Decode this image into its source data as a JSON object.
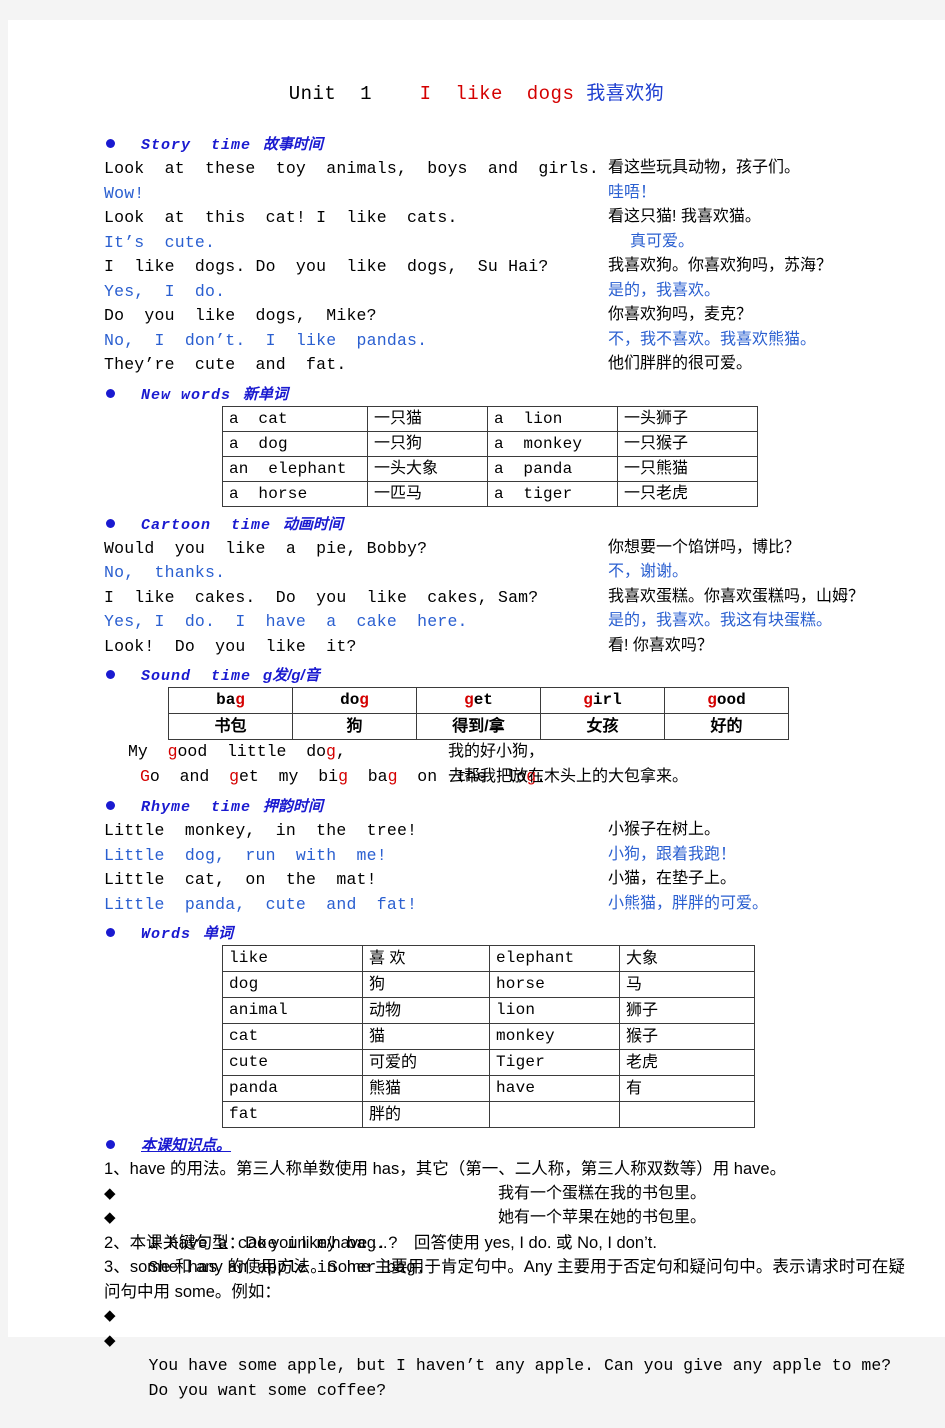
{
  "title": {
    "unit": "Unit  1",
    "en": "I  like  dogs",
    "cn": "我喜欢狗"
  },
  "sections": {
    "story": {
      "en": "Story  time",
      "cn": "故事时间",
      "lines": [
        {
          "en": "Look  at  these  toy  animals,  boys  and  girls.",
          "cn": "看这些玩具动物，孩子们。",
          "color": "black"
        },
        {
          "en": "Wow!",
          "cn": "哇唔！",
          "color": "blue"
        },
        {
          "en": "Look  at  this  cat! I  like  cats.",
          "cn": "看这只猫! 我喜欢猫。",
          "color": "black"
        },
        {
          "en": "It’s  cute.",
          "cn": "真可爱。",
          "color": "blue",
          "indent_cn": true
        },
        {
          "en": "I  like  dogs. Do  you  like  dogs,  Su Hai?",
          "cn": "我喜欢狗。你喜欢狗吗，苏海？",
          "color": "black"
        },
        {
          "en": "Yes,  I  do.",
          "cn": "是的，我喜欢。",
          "color": "blue"
        },
        {
          "en": "Do  you  like  dogs,  Mike?",
          "cn": "你喜欢狗吗，麦克？",
          "color": "black"
        },
        {
          "en": "No,  I  don’t.  I  like  pandas.",
          "cn": "不，我不喜欢。我喜欢熊猫。",
          "color": "blue"
        },
        {
          "en": "They’re  cute  and  fat.",
          "cn": "他们胖胖的很可爱。",
          "color": "black"
        }
      ]
    },
    "new_words": {
      "en": "New words",
      "cn": "新单词",
      "rows": [
        [
          "a  cat",
          "一只猫",
          "a  lion",
          "一头狮子"
        ],
        [
          "a  dog",
          "一只狗",
          "a  monkey",
          "一只猴子"
        ],
        [
          "an  elephant",
          "一头大象",
          "a  panda",
          "一只熊猫"
        ],
        [
          "a  horse",
          "一匹马",
          "a  tiger",
          "一只老虎"
        ]
      ]
    },
    "cartoon": {
      "en": "Cartoon  time",
      "cn": "动画时间",
      "lines": [
        {
          "en": "Would  you  like  a  pie, Bobby?",
          "cn": "你想要一个馅饼吗，博比？",
          "color": "black"
        },
        {
          "en": "No,  thanks.",
          "cn": "不，谢谢。",
          "color": "blue"
        },
        {
          "en": "I  like  cakes.  Do  you  like  cakes, Sam?",
          "cn": "我喜欢蛋糕。你喜欢蛋糕吗，山姆？",
          "color": "black"
        },
        {
          "en": "Yes, I  do.  I  have  a  cake  here.",
          "cn": "是的，我喜欢。我这有块蛋糕。",
          "color": "blue"
        },
        {
          "en": "Look!  Do  you  like  it?",
          "cn": "看! 你喜欢吗？",
          "color": "black"
        }
      ]
    },
    "sound": {
      "en": "Sound  time",
      "cn": "g发/g/音",
      "words": [
        {
          "pre": "ba",
          "hl": "g",
          "post": ""
        },
        {
          "pre": "do",
          "hl": "g",
          "post": ""
        },
        {
          "pre": "",
          "hl": "g",
          "post": "et"
        },
        {
          "pre": "",
          "hl": "g",
          "post": "irl"
        },
        {
          "pre": "",
          "hl": "g",
          "post": "ood"
        }
      ],
      "word_cn": [
        "书包",
        "狗",
        "得到/拿",
        "女孩",
        "好的"
      ],
      "rhyme": [
        {
          "en_parts": [
            [
              "My  ",
              0
            ],
            [
              "g",
              1
            ],
            [
              "ood  little  do",
              0
            ],
            [
              "g",
              1
            ],
            [
              ",",
              0
            ]
          ],
          "cn": "我的好小狗，"
        },
        {
          "en_parts": [
            [
              "G",
              1
            ],
            [
              "o  and  ",
              0
            ],
            [
              "g",
              1
            ],
            [
              "et  my  bi",
              0
            ],
            [
              "g",
              1
            ],
            [
              "  ba",
              0
            ],
            [
              "g",
              1
            ],
            [
              "  on  the  lo",
              0
            ],
            [
              "g",
              1
            ],
            [
              ".",
              0
            ]
          ],
          "cn": "去帮我把放在木头上的大包拿来。"
        }
      ]
    },
    "rhyme": {
      "en": "Rhyme  time",
      "cn": "押韵时间",
      "lines": [
        {
          "en": "Little  monkey,  in  the  tree!",
          "cn": "小猴子在树上。",
          "color": "black"
        },
        {
          "en": "Little  dog,  run  with  me!",
          "cn": "小狗，跟着我跑！",
          "color": "blue"
        },
        {
          "en": "Little  cat,  on  the  mat!",
          "cn": "小猫，在垫子上。",
          "color": "black"
        },
        {
          "en": "Little  panda,  cute  and  fat!",
          "cn": "小熊猫，胖胖的可爱。",
          "color": "blue"
        }
      ]
    },
    "words": {
      "en": "Words",
      "cn": "单词",
      "rows": [
        [
          "like",
          "喜 欢",
          "elephant",
          "大象"
        ],
        [
          "dog",
          "狗",
          "horse",
          "马"
        ],
        [
          "animal",
          "动物",
          "lion",
          "狮子"
        ],
        [
          "cat",
          "猫",
          "monkey",
          "猴子"
        ],
        [
          "cute",
          "可爱的",
          "Tiger",
          "老虎"
        ],
        [
          "panda",
          "熊猫",
          "have",
          "有"
        ],
        [
          "fat",
          "胖的",
          "",
          ""
        ]
      ]
    },
    "knowledge": {
      "cn": "本课知识点。",
      "point1": "1、have 的用法。第三人称单数使用 has，其它（第一、二人称，第三人称双数等）用 have。",
      "examples1": [
        {
          "en": "I have a cake in my bag.",
          "cn": "我有一个蛋糕在我的书包里。"
        },
        {
          "en": "She has an apple in her bag.",
          "cn": "她有一个苹果在她的书包里。"
        }
      ],
      "point2": "2、本课关键句型：Do you like/have …?　回答使用 yes, I do. 或 No, I don’t.",
      "point3": "3、some 和 any 的使用方法。Some 主要用于肯定句中。Any 主要用于否定句和疑问句中。表示请求时可在疑问句中用 some。例如：",
      "examples3": [
        {
          "en": "You have some apple, but I haven’t any apple. Can you give any apple to me?"
        },
        {
          "en": "Do you want some coffee?"
        }
      ]
    }
  },
  "colors": {
    "title_red": "#d40000",
    "title_blue": "#1f3fd0",
    "heading_blue": "#1a1ad0",
    "dialogue_blue": "#2a5fd0",
    "highlight_red": "#d40000",
    "page_bg": "#ffffff",
    "canvas_bg": "#f4f4f4"
  }
}
